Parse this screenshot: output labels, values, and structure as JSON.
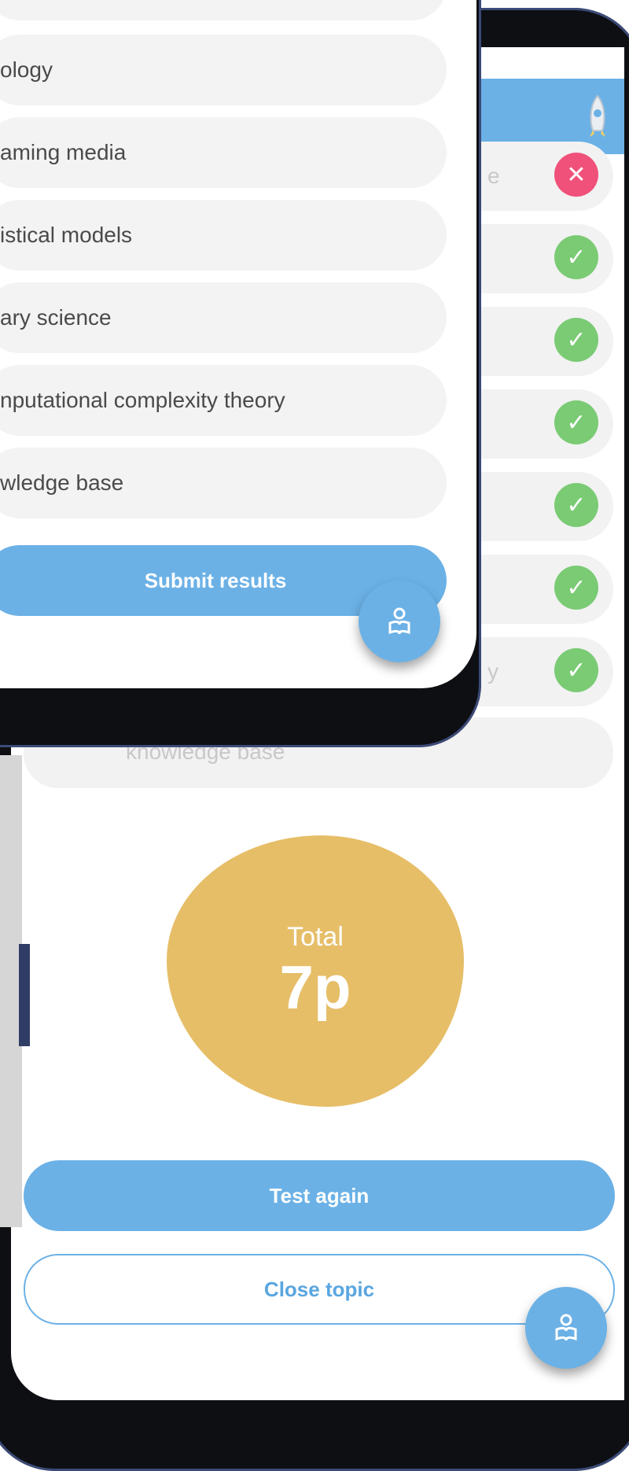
{
  "quiz_screen": {
    "options": [
      "ology",
      "aming media",
      "istical models",
      "ary science",
      "nputational complexity theory",
      "wledge base"
    ],
    "submit_label": "Submit results"
  },
  "results_screen": {
    "truncated_label_top": "e",
    "truncated_label_row": "y",
    "last_item_label": "knowledge base",
    "statuses": [
      "incorrect",
      "correct",
      "correct",
      "correct",
      "correct",
      "correct",
      "correct"
    ],
    "total_label": "Total",
    "total_value": "7p",
    "test_again_label": "Test again",
    "close_topic_label": "Close topic"
  },
  "colors": {
    "primary": "#6bb1e6",
    "correct": "#7acb74",
    "incorrect": "#f0517a",
    "total_blob": "#e6be68"
  },
  "icons": {
    "fab": "reader-icon",
    "correct": "check-icon",
    "incorrect": "close-icon",
    "header": "rocket-icon"
  }
}
